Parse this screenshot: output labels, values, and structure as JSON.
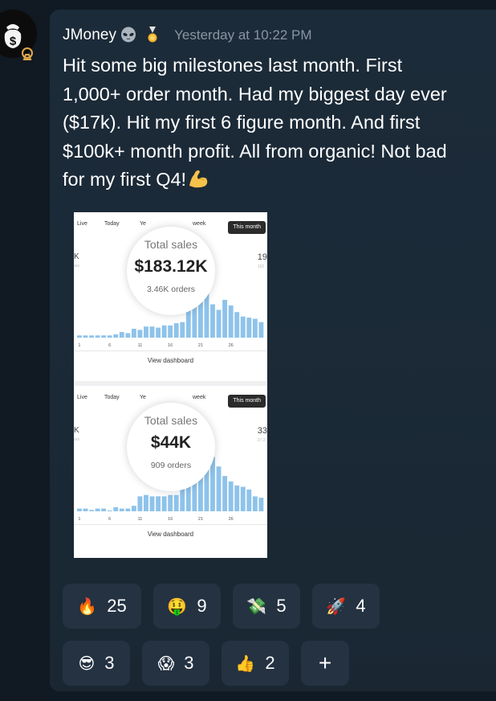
{
  "message": {
    "username": "JMoney",
    "badges": [
      "alien-icon",
      "medal-icon"
    ],
    "timestamp": "Yesterday at 10:22 PM",
    "lines": [
      "Hit some big milestones last month. First",
      "1,000+ order month. Had my biggest day ever",
      "($17k). Hit my first 6 figure month. And first",
      "$100k+ month profit. All from organic! Not bad",
      "for my first Q4!"
    ],
    "trailing_emoji": "flexed-biceps-icon"
  },
  "attachment": {
    "panels": [
      {
        "tabs": [
          "Live",
          "Today",
          "Ye",
          "week",
          "This month"
        ],
        "left_value": "K",
        "left_faint": "ars",
        "right_value": "19",
        "right_faint": "162",
        "label": "Total sales",
        "value": "$183.12K",
        "sub": "3.46K orders",
        "x_ticks": [
          "1",
          "6",
          "11",
          "16",
          "21",
          "26"
        ],
        "footer": "View dashboard"
      },
      {
        "tabs": [
          "Live",
          "Today",
          "Ye",
          "week",
          "This month"
        ],
        "left_value": "K",
        "left_faint": "ars",
        "right_value": "33",
        "right_faint": "27.2",
        "label": "Total sales",
        "value": "$44K",
        "sub": "909 orders",
        "x_ticks": [
          "1",
          "6",
          "11",
          "16",
          "21",
          "26"
        ],
        "footer": "View dashboard"
      }
    ]
  },
  "chart_data": [
    {
      "type": "bar",
      "categories": [
        "1",
        "2",
        "3",
        "4",
        "5",
        "6",
        "7",
        "8",
        "9",
        "10",
        "11",
        "12",
        "13",
        "14",
        "15",
        "16",
        "17",
        "18",
        "19",
        "20",
        "21",
        "22",
        "23",
        "24",
        "25",
        "26",
        "27",
        "28",
        "29",
        "30",
        "31"
      ],
      "values": [
        2,
        2,
        2,
        2,
        2,
        2,
        3,
        5,
        4,
        8,
        7,
        10,
        10,
        9,
        11,
        11,
        13,
        14,
        25,
        28,
        32,
        50,
        30,
        25,
        34,
        29,
        23,
        19,
        18,
        17,
        14
      ],
      "ylim": [
        0,
        55
      ]
    },
    {
      "type": "bar",
      "categories": [
        "1",
        "2",
        "3",
        "4",
        "5",
        "6",
        "7",
        "8",
        "9",
        "10",
        "11",
        "12",
        "13",
        "14",
        "15",
        "16",
        "17",
        "18",
        "19",
        "20",
        "21",
        "22",
        "23",
        "24",
        "25",
        "26",
        "27",
        "28",
        "29",
        "30",
        "31"
      ],
      "values": [
        2,
        2,
        1,
        2,
        2,
        0,
        3,
        2,
        2,
        4,
        11,
        12,
        11,
        11,
        11,
        12,
        12,
        25,
        30,
        29,
        38,
        42,
        40,
        33,
        26,
        22,
        19,
        18,
        16,
        11,
        10
      ],
      "ylim": [
        0,
        45
      ]
    }
  ],
  "reactions": [
    {
      "emoji": "🔥",
      "icon": "fire-icon",
      "count": "25"
    },
    {
      "emoji": "🤑",
      "icon": "money-mouth-face-icon",
      "count": "9"
    },
    {
      "emoji": "💸",
      "icon": "money-with-wings-icon",
      "count": "5"
    },
    {
      "emoji": "🚀",
      "icon": "rocket-icon",
      "count": "4"
    },
    {
      "emoji": "😎",
      "icon": "sunglasses-face-icon",
      "count": "3"
    },
    {
      "emoji": "😱",
      "icon": "screaming-face-icon",
      "count": "3"
    },
    {
      "emoji": "👍",
      "icon": "thumbs-up-icon",
      "count": "2"
    }
  ],
  "add_reaction_label": "+",
  "colors": {
    "background": "#101a24",
    "card": "#1c2b39",
    "pill": "#243242",
    "timestamp": "#8994a0",
    "bar": "#8ec3ea"
  }
}
